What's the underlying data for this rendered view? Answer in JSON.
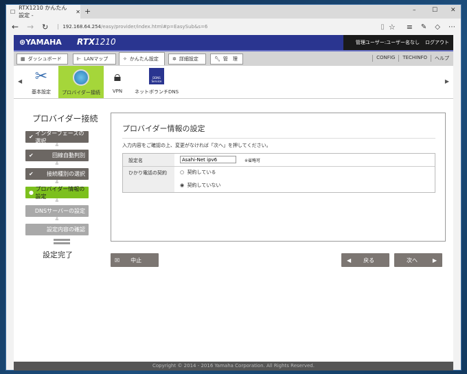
{
  "browser": {
    "tab_title": "RTX1210 かんたん設定 - ",
    "url_host": "192.168.64.254",
    "url_path": "/easy/provider/index.html#p=EasySub&s=6"
  },
  "header": {
    "brand": "YAMAHA",
    "model_prefix": "RTX",
    "model_num": "1210",
    "user": "管理ユーザー:ユーザー名なし",
    "logout": "ログアウト"
  },
  "nav": {
    "items": [
      "ダッシュボード",
      "LANマップ",
      "かんたん設定",
      "詳細設定",
      "管　理"
    ],
    "links": [
      "CONFIG",
      "TECHINFO",
      "ヘルプ"
    ]
  },
  "icons": [
    "基本設定",
    "プロバイダー接続",
    "VPN",
    "ネットボランチDNS"
  ],
  "dns_icon_text": "DDNS Service",
  "wizard": {
    "title": "プロバイダー接続",
    "steps": [
      "インターフェースの選択",
      "回線自動判別",
      "接続種別の選択",
      "プロバイダー情報の設定",
      "DNSサーバーの設定",
      "設定内容の確認"
    ],
    "complete": "設定完了"
  },
  "form": {
    "title": "プロバイダー情報の設定",
    "instruction": "入力内容をご確認の上、変更がなければ「次へ」を押してください。",
    "name_label": "設定名",
    "name_value": "Asahi-Net ipv6",
    "name_note": "※省略可",
    "phone_label": "ひかり電話の契約",
    "opt_yes": "契約している",
    "opt_no": "契約していない"
  },
  "buttons": {
    "cancel": "中止",
    "back": "戻る",
    "next": "次へ"
  },
  "footer": "Copyright © 2014 - 2016 Yamaha Corporation. All Rights Reserved."
}
